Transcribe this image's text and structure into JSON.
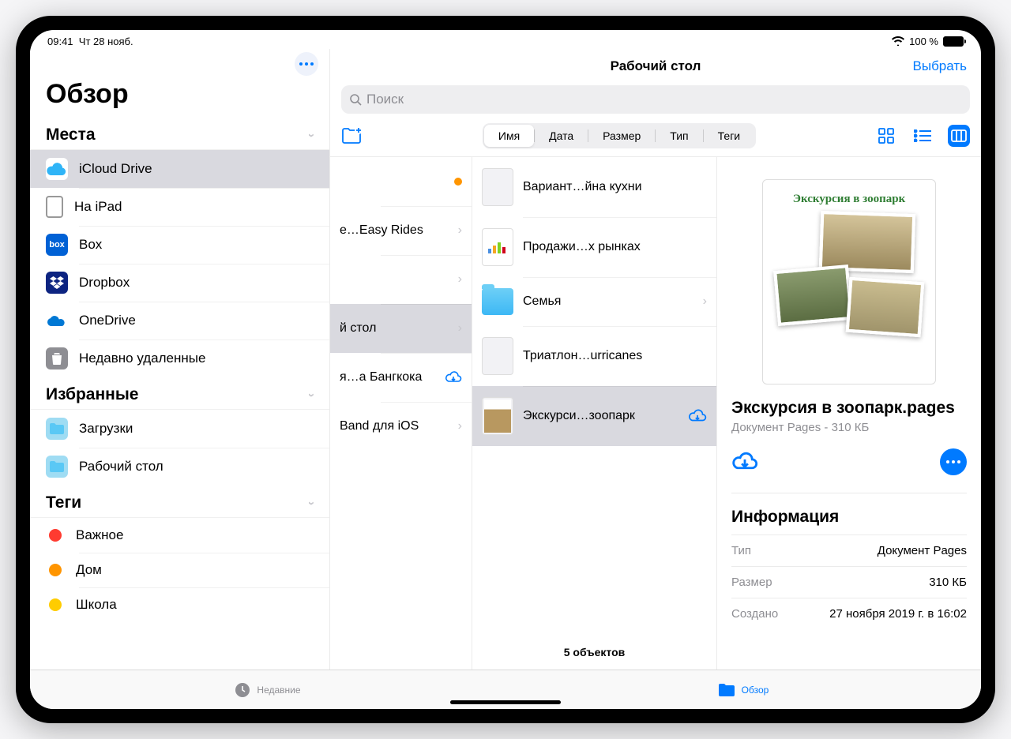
{
  "status": {
    "time": "09:41",
    "date": "Чт 28 нояб.",
    "battery": "100 %"
  },
  "sidebar": {
    "more_icon": "more",
    "title": "Обзор",
    "sections": {
      "places": {
        "title": "Места"
      },
      "favorites": {
        "title": "Избранные"
      },
      "tags": {
        "title": "Теги"
      }
    },
    "places": [
      {
        "label": "iCloud Drive",
        "color": "#fff",
        "selected": true
      },
      {
        "label": "На iPad"
      },
      {
        "label": "Box"
      },
      {
        "label": "Dropbox"
      },
      {
        "label": "OneDrive"
      },
      {
        "label": "Недавно удаленные"
      }
    ],
    "favorites": [
      {
        "label": "Загрузки"
      },
      {
        "label": "Рабочий стол"
      }
    ],
    "tags": [
      {
        "label": "Важное",
        "color": "#ff3b30"
      },
      {
        "label": "Дом",
        "color": "#ff9500"
      },
      {
        "label": "Школа",
        "color": "#ffcc00"
      }
    ]
  },
  "pane": {
    "title": "Рабочий стол",
    "select": "Выбрать",
    "search_placeholder": "Поиск",
    "sort": {
      "name": "Имя",
      "date": "Дата",
      "size": "Размер",
      "type": "Тип",
      "tags": "Теги"
    }
  },
  "col1": [
    {
      "label": "",
      "dot": true
    },
    {
      "label": "e…Easy Rides",
      "chev": true
    },
    {
      "label": "",
      "chev": true
    },
    {
      "label": "й стол",
      "chev": true,
      "selected": true
    },
    {
      "label": "я…а Бангкока",
      "cloud": true
    },
    {
      "label": "Band для iOS",
      "chev": true
    }
  ],
  "col2_footer": "5 объектов",
  "col2": [
    {
      "label": "Вариант…йна кухни"
    },
    {
      "label": "Продажи…х рынках"
    },
    {
      "label": "Семья",
      "folder": true,
      "chev": true
    },
    {
      "label": "Триатлон…urricanes"
    },
    {
      "label": "Экскурси…зоопарк",
      "selected": true,
      "cloud": true
    }
  ],
  "detail": {
    "preview_title": "Экскурсия в зоопарк",
    "filename": "Экскурсия в зоопарк.pages",
    "subtitle": "Документ Pages - 310 КБ",
    "info_title": "Информация",
    "rows": [
      {
        "k": "Тип",
        "v": "Документ Pages"
      },
      {
        "k": "Размер",
        "v": "310 КБ"
      },
      {
        "k": "Создано",
        "v": "27 ноября 2019 г. в 16:02"
      }
    ]
  },
  "tabs": {
    "recent": "Недавние",
    "browse": "Обзор"
  }
}
